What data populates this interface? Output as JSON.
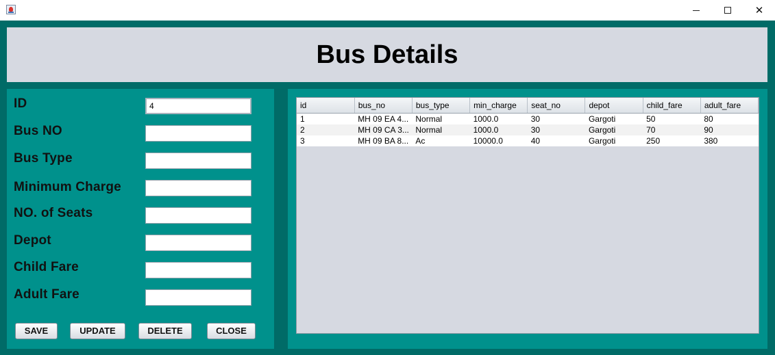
{
  "window": {
    "minimize_icon": "minimize-icon",
    "maximize_icon": "maximize-icon",
    "close_glyph": "✕"
  },
  "header": {
    "title": "Bus Details"
  },
  "form": {
    "fields": [
      {
        "label": "ID",
        "value": "4"
      },
      {
        "label": "Bus NO",
        "value": ""
      },
      {
        "label": "Bus Type",
        "value": ""
      },
      {
        "label": "Minimum Charge",
        "value": ""
      },
      {
        "label": "NO. of Seats",
        "value": ""
      },
      {
        "label": "Depot",
        "value": ""
      },
      {
        "label": "Child Fare",
        "value": ""
      },
      {
        "label": "Adult Fare",
        "value": ""
      }
    ],
    "buttons": {
      "save": "SAVE",
      "update": "UPDATE",
      "delete": "DELETE",
      "close": "CLOSE"
    }
  },
  "table": {
    "columns": [
      "id",
      "bus_no",
      "bus_type",
      "min_charge",
      "seat_no",
      "depot",
      "child_fare",
      "adult_fare"
    ],
    "rows": [
      [
        "1",
        "MH 09 EA 4...",
        "Normal",
        "1000.0",
        "30",
        "Gargoti",
        "50",
        "80"
      ],
      [
        "2",
        "MH 09 CA 3...",
        "Normal",
        "1000.0",
        "30",
        "Gargoti",
        "70",
        "90"
      ],
      [
        "3",
        "MH 09 BA 8...",
        "Ac",
        "10000.0",
        "40",
        "Gargoti",
        "250",
        "380"
      ]
    ]
  },
  "colors": {
    "frame": "#006b67",
    "panel": "#00918c",
    "header_bg": "#d6d9e1"
  }
}
